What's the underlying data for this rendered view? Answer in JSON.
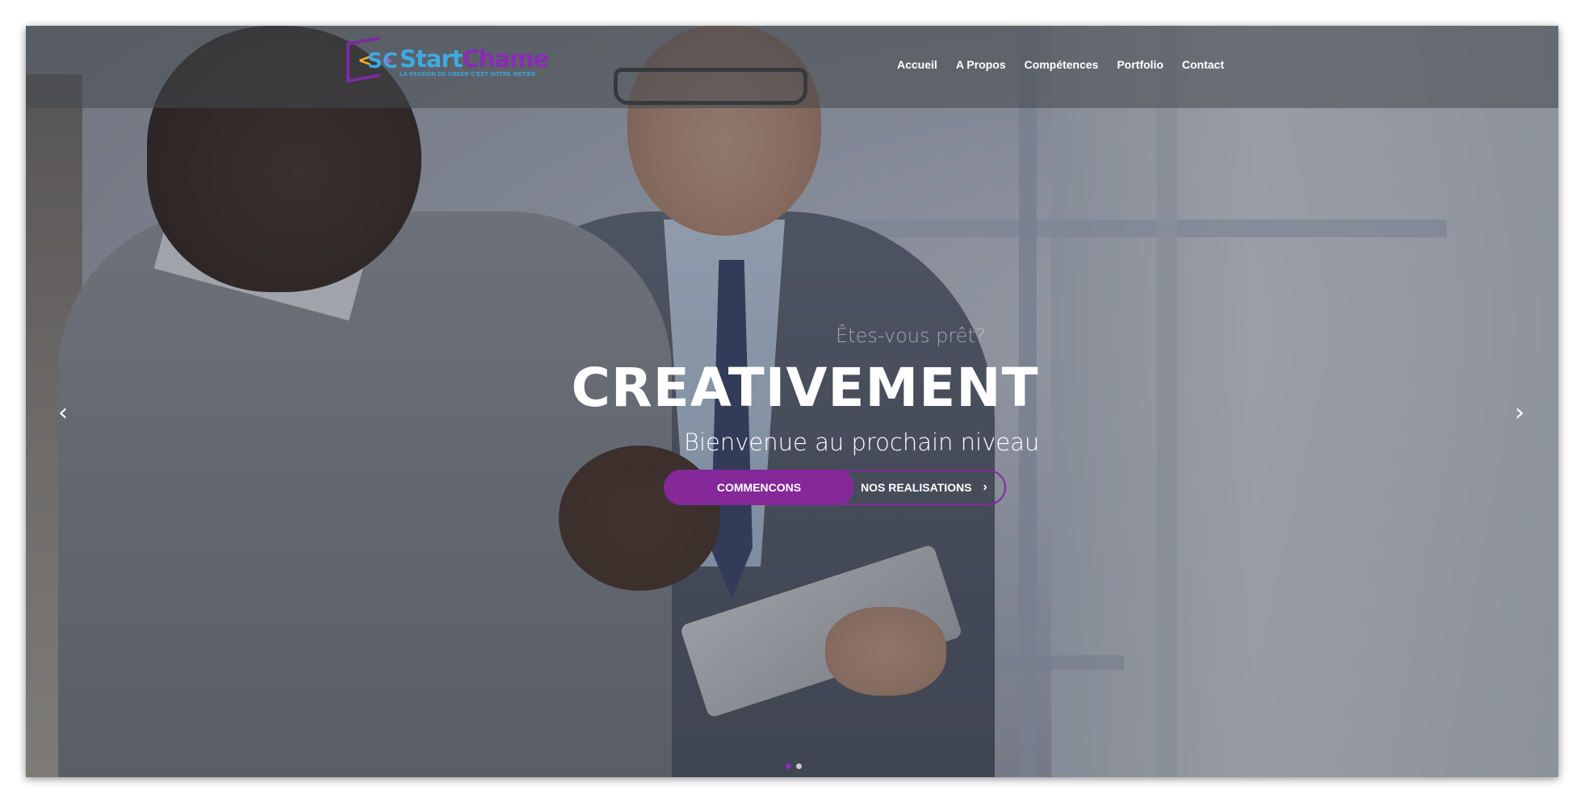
{
  "brand": {
    "logo_symbol_left": "<",
    "logo_symbol_initials": "SC",
    "logo_symbol_right": ">",
    "name_part1": "Start",
    "name_part2": "Chame",
    "tagline": "LA PASSION DE CREER C'EST NOTRE METIER",
    "colors": {
      "blue": "#3fa9e0",
      "purple": "#8a2bb5",
      "accent": "#84289a"
    }
  },
  "nav": {
    "items": [
      {
        "label": "Accueil"
      },
      {
        "label": "A Propos"
      },
      {
        "label": "Compétences"
      },
      {
        "label": "Portfolio"
      },
      {
        "label": "Contact"
      }
    ]
  },
  "hero": {
    "pretitle": "Êtes-vous prêt?",
    "title": "CREATIVEMENT",
    "subtitle": "Bienvenue au prochain niveau",
    "primary_button": "COMMENCONS",
    "secondary_button": "NOS REALISATIONS",
    "secondary_icon": "chevron-right-icon"
  },
  "carousel": {
    "prev_icon": "chevron-left-icon",
    "next_icon": "chevron-right-icon",
    "prev_glyph": "‹",
    "next_glyph": "›",
    "slide_count": 2,
    "active_index": 0
  }
}
